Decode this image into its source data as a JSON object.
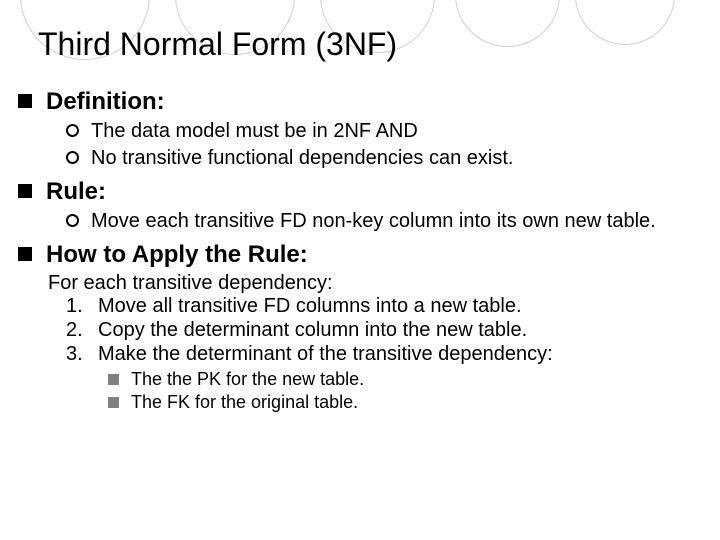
{
  "title": "Third Normal Form (3NF)",
  "sections": [
    {
      "heading": "Definition:",
      "items": [
        "The data model must be in 2NF  AND",
        "No transitive functional dependencies can exist."
      ]
    },
    {
      "heading": "Rule:",
      "items": [
        "Move each transitive FD non-key column into its own new table."
      ]
    },
    {
      "heading": "How to Apply the Rule:",
      "intro": "For each transitive dependency:",
      "numbered": [
        "Move all transitive FD columns into a new table.",
        "Copy the determinant column into the new table.",
        "Make the determinant of the transitive dependency:"
      ],
      "subsquares": [
        "The the PK for the new table.",
        "The FK for the original table."
      ]
    }
  ]
}
